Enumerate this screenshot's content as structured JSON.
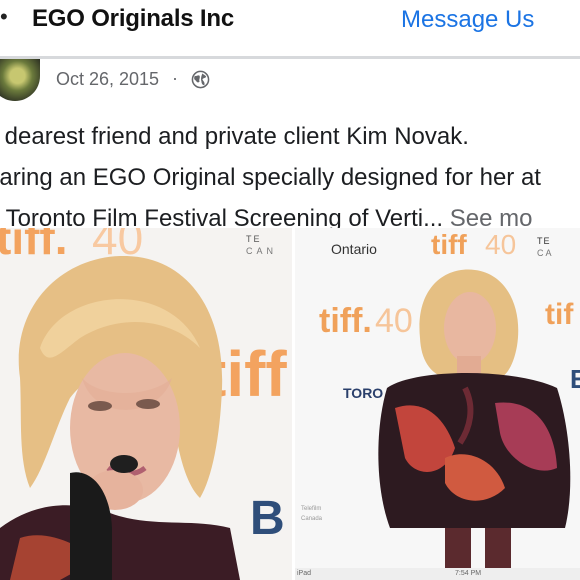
{
  "header": {
    "back_icon": "back-arrow-icon",
    "title": "EGO Originals Inc",
    "message_button": "Message Us",
    "accent_color": "#1b74e4"
  },
  "post": {
    "date": "Oct 26, 2015",
    "separator": "·",
    "privacy_icon": "globe-icon",
    "text_lines": [
      "y dearest friend and private client Kim Novak.",
      "earing an EGO Original specially designed for her at",
      "e Toronto Film Festival Screening of Verti..."
    ],
    "see_more": " See mo"
  },
  "photos": {
    "left": {
      "logo_text_top": "tiff.40",
      "logo_text_right": "tiff",
      "letters_top_right": "T E\nC A N",
      "letter_b": "B"
    },
    "right": {
      "ontario": "Ontario",
      "logo_top": "tiff",
      "logo_top_suffix": "40",
      "logo_mid": "tiff.",
      "logo_mid_suffix": "40",
      "logo_far_right": "tif",
      "letters_top_right": "TE\nCA",
      "toronto_logo": "TORO",
      "letter_e": "E"
    },
    "strip": {
      "left_text": "iPad",
      "mid_text": "7:54 PM"
    }
  }
}
